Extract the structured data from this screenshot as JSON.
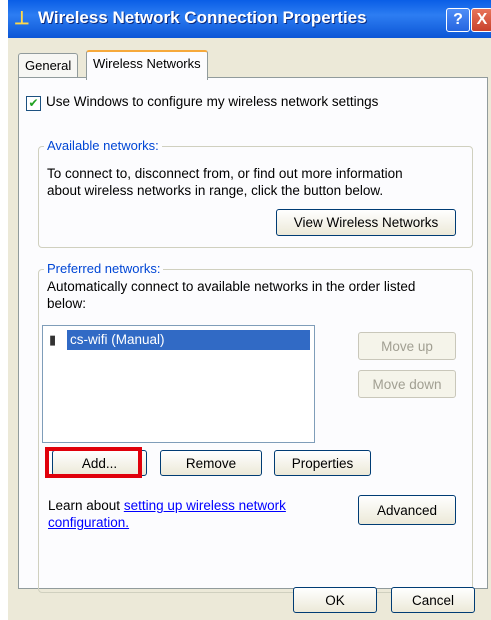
{
  "window": {
    "title": "Wireless Network Connection Properties",
    "help_glyph": "?",
    "close_glyph": "X"
  },
  "tabs": [
    {
      "label": "General"
    },
    {
      "label": "Wireless Networks"
    }
  ],
  "use_windows_checkbox": {
    "label": "Use Windows to configure my wireless network settings",
    "checked": true
  },
  "available": {
    "title": "Available networks:",
    "description_line1": "To connect to, disconnect from, or find out more information",
    "description_line2": "about wireless networks in range, click the button below.",
    "view_button": "View Wireless Networks"
  },
  "preferred": {
    "title": "Preferred networks:",
    "description_line1": "Automatically connect to available networks in the order listed",
    "description_line2": "below:",
    "networks": [
      {
        "label": "cs-wifi (Manual)",
        "selected": true
      }
    ],
    "move_up": "Move up",
    "move_down": "Move down",
    "add": "Add...",
    "remove": "Remove",
    "properties": "Properties",
    "learn_prefix": "Learn about ",
    "learn_link_line1": "setting up wireless network",
    "learn_link_line2": "configuration.",
    "advanced": "Advanced"
  },
  "footer": {
    "ok": "OK",
    "cancel": "Cancel"
  },
  "colors": {
    "titlebar": "#0a5ee6",
    "group_title": "#0046d5",
    "selection": "#316ac5",
    "highlight_box": "#e0000b"
  }
}
